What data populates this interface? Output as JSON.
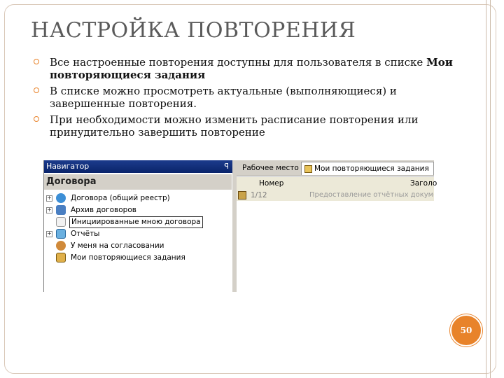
{
  "slide": {
    "title": "НАСТРОЙКА ПОВТОРЕНИЯ",
    "bullets": [
      {
        "text": "Все настроенные повторения доступны для пользователя в списке ",
        "bold": "Мои повторяющиеся задания"
      },
      {
        "text": "В списке можно просмотреть актуальные (выполняющиеся) и завершенные повторения.",
        "bold": ""
      },
      {
        "text": "При необходимости можно изменить расписание повторения или принудительно завершить повторение",
        "bold": ""
      }
    ],
    "page_number": "50",
    "accent_color": "#e8832a"
  },
  "screenshot": {
    "navigator": {
      "header": "Навигатор",
      "pin_icon": "pin-icon",
      "section": "Договора",
      "items": [
        {
          "label": "Договора (общий реестр)",
          "icon": "registry-icon",
          "expandable": true
        },
        {
          "label": "Архив договоров",
          "icon": "archive-lock-icon",
          "expandable": true
        },
        {
          "label": "Инициированные мною договора",
          "icon": "document-icon",
          "expandable": false
        },
        {
          "label": "Отчёты",
          "icon": "reports-icon",
          "expandable": true
        },
        {
          "label": "У меня на согласовании",
          "icon": "user-icon",
          "expandable": false
        },
        {
          "label": "Мои повторяющиеся задания",
          "icon": "repeat-tasks-icon",
          "expandable": false
        }
      ]
    },
    "tabs": [
      {
        "label": "Рабочее место"
      },
      {
        "label": "Мои повторяющиеся задания"
      }
    ],
    "grid": {
      "columns": [
        "Номер",
        "Заголо"
      ],
      "rows": [
        {
          "number": "1/12",
          "title": "Предоставление отчётных докумен"
        }
      ]
    }
  }
}
